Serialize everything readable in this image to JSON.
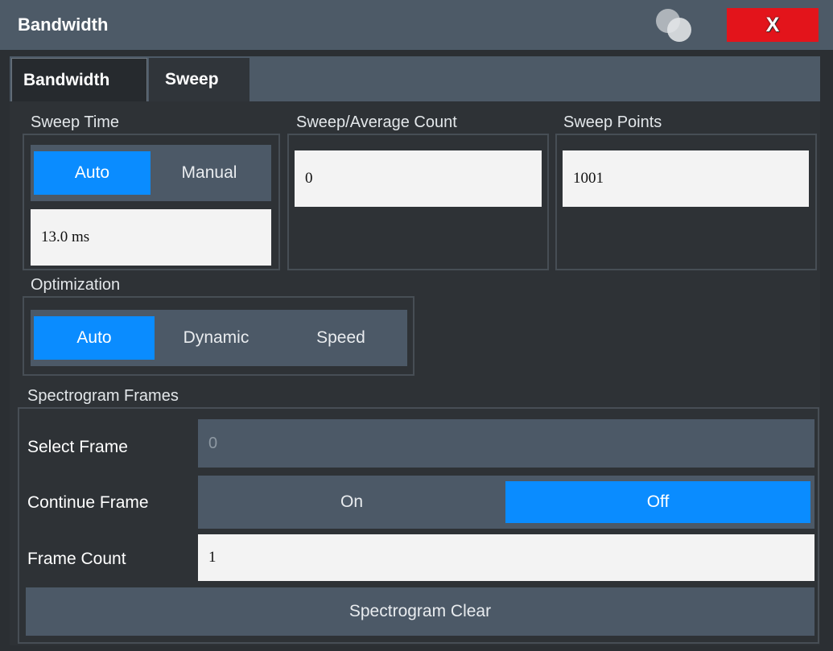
{
  "window": {
    "title": "Bandwidth",
    "close_label": "X",
    "icon": "overlapping-circles-icon"
  },
  "tabs": [
    {
      "label": "Bandwidth",
      "selected": false
    },
    {
      "label": "Sweep",
      "selected": true
    }
  ],
  "sweep_time": {
    "label": "Sweep Time",
    "options": [
      "Auto",
      "Manual"
    ],
    "selected": "Auto",
    "value": "13.0 ms"
  },
  "sweep_average_count": {
    "label": "Sweep/Average Count",
    "value": "0"
  },
  "sweep_points": {
    "label": "Sweep Points",
    "value": "1001"
  },
  "optimization": {
    "label": "Optimization",
    "options": [
      "Auto",
      "Dynamic",
      "Speed"
    ],
    "selected": "Auto"
  },
  "spectrogram_frames": {
    "label": "Spectrogram Frames",
    "select_frame": {
      "label": "Select Frame",
      "value": "0"
    },
    "continue_frame": {
      "label": "Continue Frame",
      "options": [
        "On",
        "Off"
      ],
      "selected": "Off"
    },
    "frame_count": {
      "label": "Frame Count",
      "value": "1"
    },
    "clear_button": "Spectrogram Clear"
  },
  "colors": {
    "accent": "#0a8cff",
    "close": "#e3141b",
    "title_bar": "#4d5a67",
    "toggle_background": "#4c5967",
    "panel": "#2e3236"
  }
}
